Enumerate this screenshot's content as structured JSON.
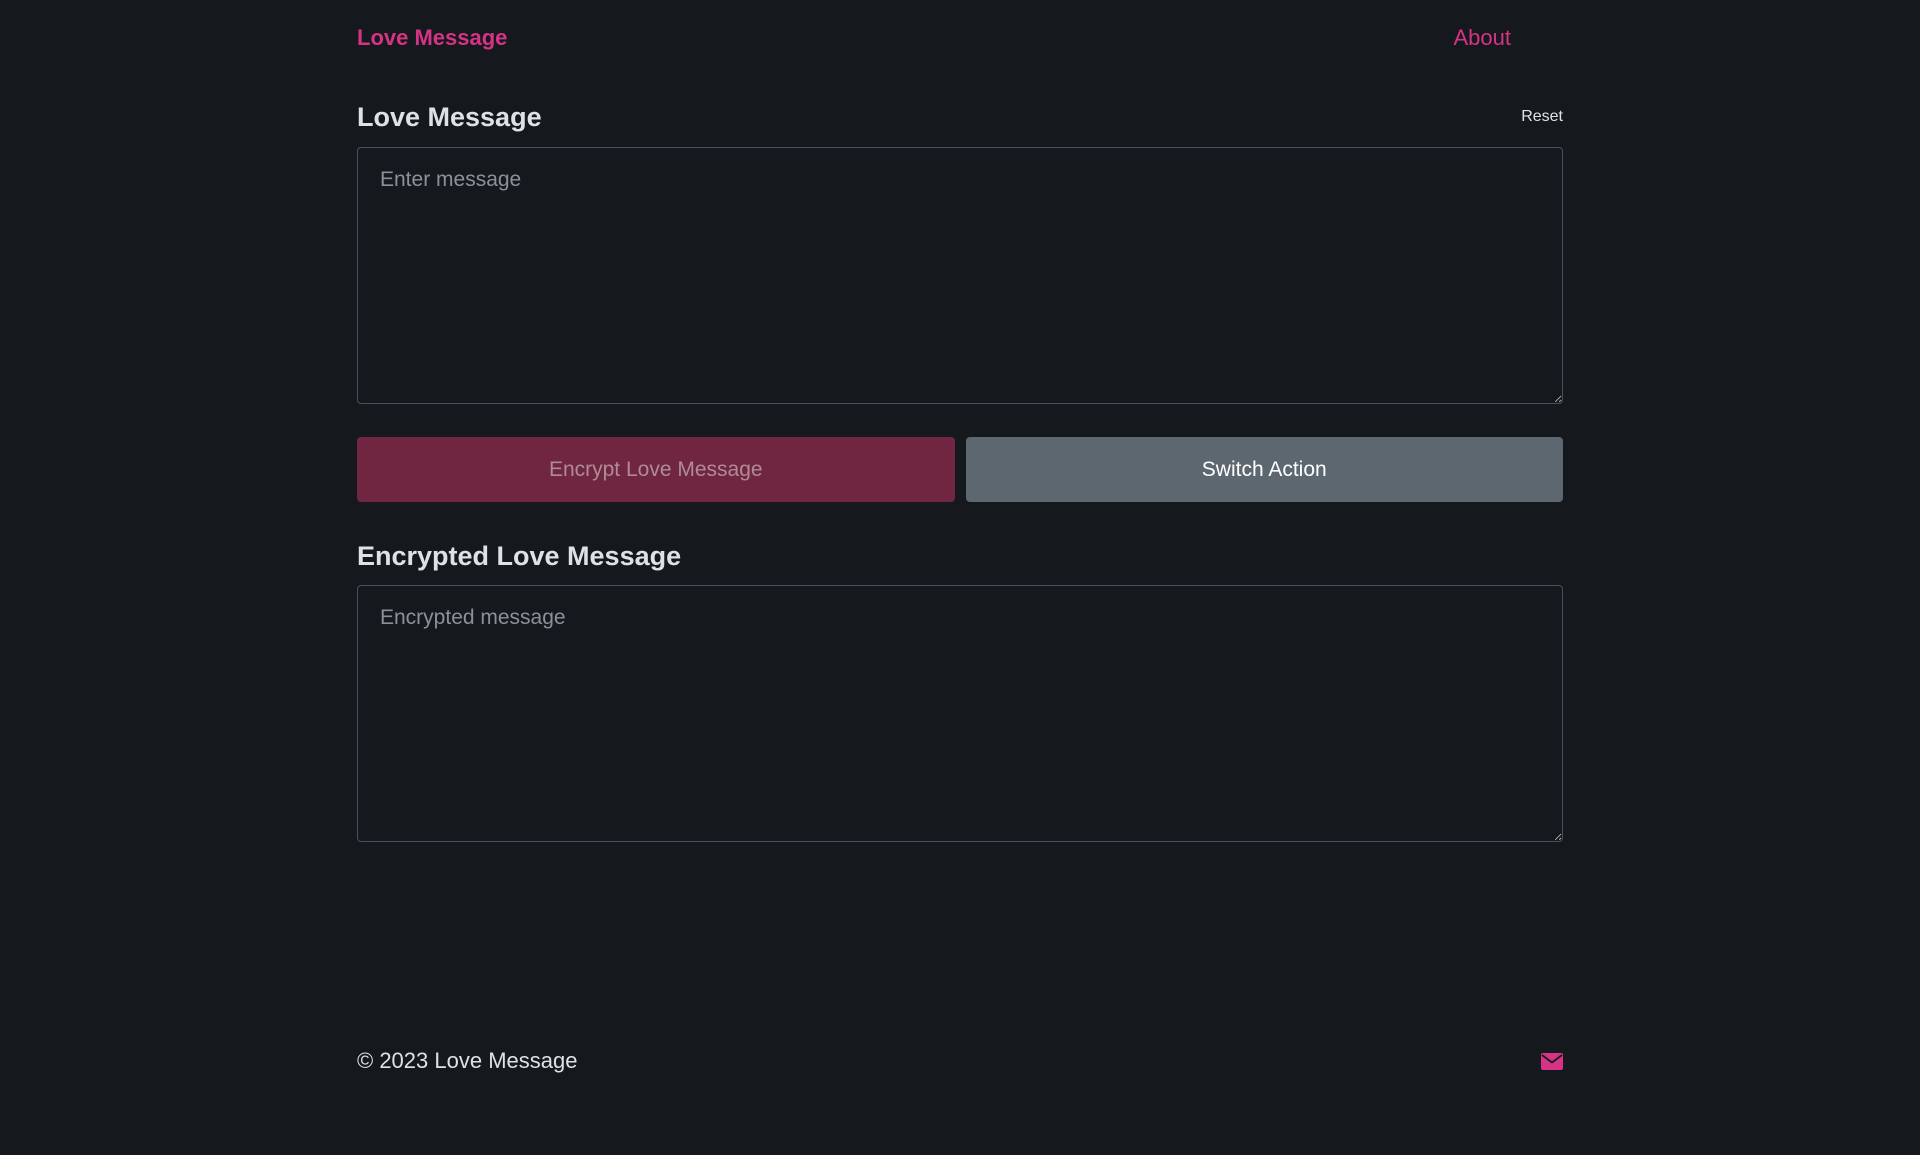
{
  "nav": {
    "brand": "Love Message",
    "about": "About",
    "theme_icon": "moon-icon"
  },
  "input_section": {
    "title": "Love Message",
    "reset": "Reset",
    "placeholder": "Enter message",
    "value": ""
  },
  "actions": {
    "encrypt_label": "Encrypt Love Message",
    "switch_label": "Switch Action"
  },
  "output_section": {
    "title": "Encrypted Love Message",
    "placeholder": "Encrypted message",
    "value": ""
  },
  "footer": {
    "copyright": "© 2023 Love Message",
    "contact_icon": "envelope-icon"
  },
  "colors": {
    "background": "#15191e",
    "accent": "#d63384",
    "primary_button": "#702640",
    "secondary_button": "#5c6770",
    "text": "#dee2e6",
    "border": "#495057"
  }
}
